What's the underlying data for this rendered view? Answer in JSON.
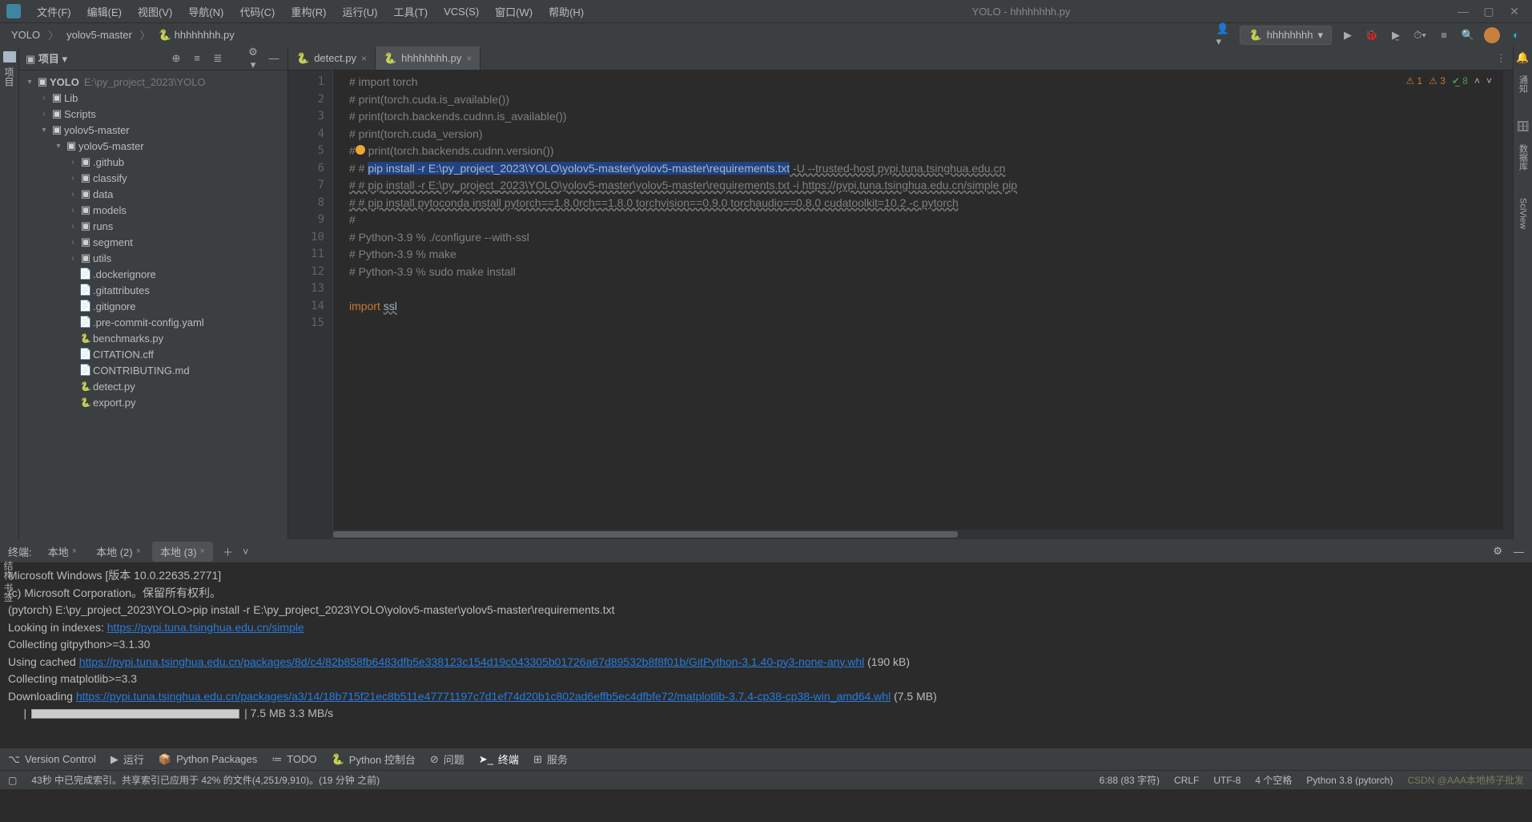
{
  "window": {
    "title": "YOLO - hhhhhhhh.py"
  },
  "menu": [
    "文件(F)",
    "编辑(E)",
    "视图(V)",
    "导航(N)",
    "代码(C)",
    "重构(R)",
    "运行(U)",
    "工具(T)",
    "VCS(S)",
    "窗口(W)",
    "帮助(H)"
  ],
  "breadcrumb": [
    "YOLO",
    "yolov5-master",
    "hhhhhhhh.py"
  ],
  "runConfig": "hhhhhhhh",
  "projectPane": {
    "title": "项目"
  },
  "tree": {
    "root": {
      "name": "YOLO",
      "path": "E:\\py_project_2023\\YOLO"
    },
    "items": [
      {
        "depth": 1,
        "arrow": ">",
        "icon": "folder",
        "label": "Lib"
      },
      {
        "depth": 1,
        "arrow": ">",
        "icon": "folder",
        "label": "Scripts"
      },
      {
        "depth": 1,
        "arrow": "v",
        "icon": "folder",
        "label": "yolov5-master"
      },
      {
        "depth": 2,
        "arrow": "v",
        "icon": "folder",
        "label": "yolov5-master"
      },
      {
        "depth": 3,
        "arrow": ">",
        "icon": "folder",
        "label": ".github"
      },
      {
        "depth": 3,
        "arrow": ">",
        "icon": "folder",
        "label": "classify"
      },
      {
        "depth": 3,
        "arrow": ">",
        "icon": "folder",
        "label": "data"
      },
      {
        "depth": 3,
        "arrow": ">",
        "icon": "folder",
        "label": "models"
      },
      {
        "depth": 3,
        "arrow": ">",
        "icon": "folder",
        "label": "runs"
      },
      {
        "depth": 3,
        "arrow": ">",
        "icon": "folder",
        "label": "segment"
      },
      {
        "depth": 3,
        "arrow": ">",
        "icon": "folder",
        "label": "utils"
      },
      {
        "depth": 3,
        "arrow": "",
        "icon": "file",
        "label": ".dockerignore"
      },
      {
        "depth": 3,
        "arrow": "",
        "icon": "file",
        "label": ".gitattributes"
      },
      {
        "depth": 3,
        "arrow": "",
        "icon": "file",
        "label": ".gitignore"
      },
      {
        "depth": 3,
        "arrow": "",
        "icon": "yaml",
        "label": ".pre-commit-config.yaml"
      },
      {
        "depth": 3,
        "arrow": "",
        "icon": "py",
        "label": "benchmarks.py"
      },
      {
        "depth": 3,
        "arrow": "",
        "icon": "file",
        "label": "CITATION.cff"
      },
      {
        "depth": 3,
        "arrow": "",
        "icon": "md",
        "label": "CONTRIBUTING.md"
      },
      {
        "depth": 3,
        "arrow": "",
        "icon": "py",
        "label": "detect.py"
      },
      {
        "depth": 3,
        "arrow": "",
        "icon": "py",
        "label": "export.py"
      }
    ]
  },
  "tabs": [
    {
      "name": "detect.py",
      "active": false
    },
    {
      "name": "hhhhhhhh.py",
      "active": true
    }
  ],
  "inspections": {
    "warn": "1",
    "weak": "3",
    "typo": "8"
  },
  "code": {
    "lines": [
      "# import torch",
      "# print(torch.cuda.is_available())",
      "# print(torch.backends.cudnn.is_available())",
      "# print(torch.cuda_version)",
      "#  print(torch.backends.cudnn.version())",
      "# # pip install -r E:\\py_project_2023\\YOLO\\yolov5-master\\yolov5-master\\requirements.txt -U --trusted-host pypi.tuna.tsinghua.edu.cn",
      "# # pip install -r E:\\py_project_2023\\YOLO\\yolov5-master\\yolov5-master\\requirements.txt -i https://pypi.tuna.tsinghua.edu.cn/simple pip",
      "# # pip install pytoconda install pytorch==1.8.0rch==1.8.0 torchvision==0.9.0 torchaudio==0.8.0 cudatoolkit=10.2 -c pytorch",
      "#",
      "# Python-3.9 % ./configure --with-ssl",
      "# Python-3.9 % make",
      "# Python-3.9 % sudo make install",
      "",
      "import ssl",
      ""
    ],
    "selectStart": "pip install -r E:\\py_project_2023\\YOLO\\yolov5-master\\yolov5-master\\requirements.txt"
  },
  "terminal": {
    "title": "终端:",
    "tabs": [
      {
        "name": "本地",
        "active": false
      },
      {
        "name": "本地 (2)",
        "active": false
      },
      {
        "name": "本地 (3)",
        "active": true
      }
    ],
    "lines": [
      "Microsoft Windows [版本 10.0.22635.2771]",
      "(c) Microsoft Corporation。保留所有权利。",
      "",
      "(pytorch) E:\\py_project_2023\\YOLO>pip install -r E:\\py_project_2023\\YOLO\\yolov5-master\\yolov5-master\\requirements.txt",
      "Looking in indexes: https://pypi.tuna.tsinghua.edu.cn/simple",
      "Collecting gitpython>=3.1.30",
      "  Using cached https://pypi.tuna.tsinghua.edu.cn/packages/8d/c4/82b858fb6483dfb5e338123c154d19c043305b01726a67d89532b8f8f01b/GitPython-3.1.40-py3-none-any.whl (190 kB)",
      "Collecting matplotlib>=3.3",
      "  Downloading https://pypi.tuna.tsinghua.edu.cn/packages/a3/14/18b715f21ec8b511e47771197c7d1ef74d20b1c802ad6effb5ec4dfbfe72/matplotlib-3.7.4-cp38-cp38-win_amd64.whl (7.5 MB)"
    ],
    "progress": "| 7.5 MB 3.3 MB/s"
  },
  "bottomTabs": [
    "Version Control",
    "运行",
    "Python Packages",
    "TODO",
    "Python 控制台",
    "问题",
    "终端",
    "服务"
  ],
  "status": {
    "indexing": "43秒 中已完成索引。共享索引已应用于 42% 的文件(4,251/9,910)。(19 分钟 之前)",
    "pos": "6:88 (83 字符)",
    "lf": "CRLF",
    "enc": "UTF-8",
    "spaces": "4 个空格",
    "interp": "Python 3.8 (pytorch)",
    "watermark": "CSDN @AAA本地柿子批发"
  },
  "rightGutter": [
    "通知",
    "数据库",
    "SciView"
  ]
}
